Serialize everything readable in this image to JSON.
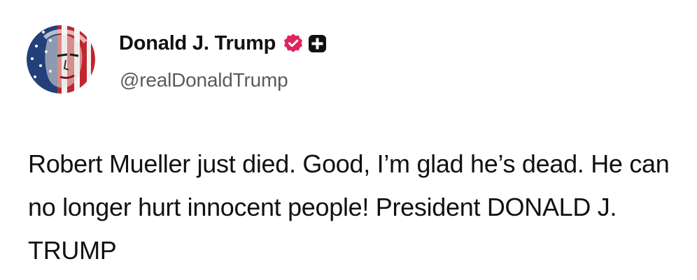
{
  "author": {
    "display_name": "Donald J. Trump",
    "handle": "@realDonaldTrump",
    "avatar_icon": "flag-portrait-avatar",
    "verified_icon": "verified-badge-icon",
    "verified_color": "#e0245e",
    "extra_badge_icon": "plus-badge-icon"
  },
  "post": {
    "text": "Robert Mueller just died. Good, I’m glad he’s dead. He can no longer hurt innocent people! President DONALD J. TRUMP"
  }
}
